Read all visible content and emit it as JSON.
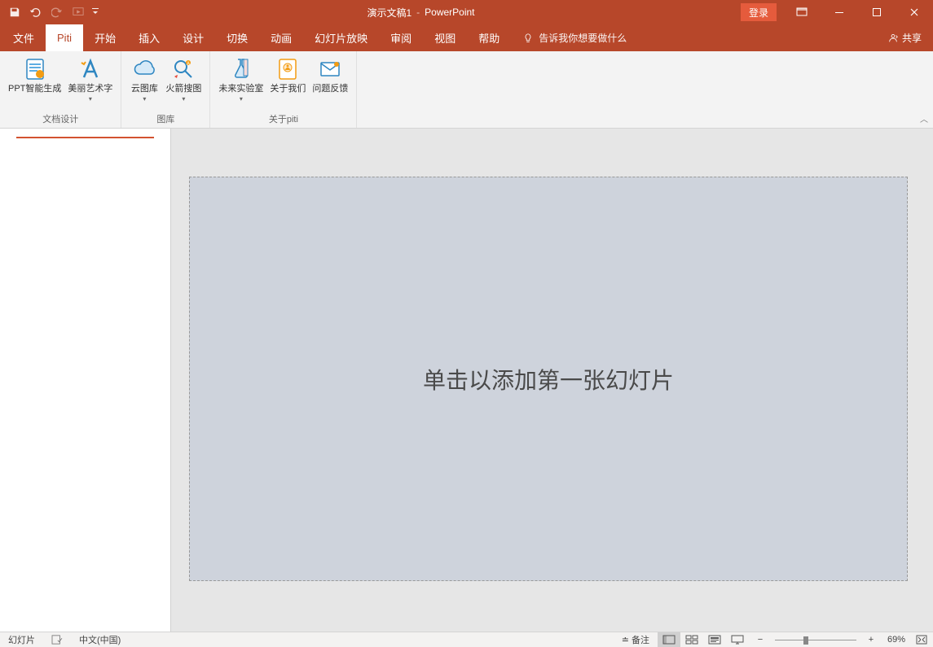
{
  "title": {
    "document": "演示文稿1",
    "separator": "-",
    "app": "PowerPoint"
  },
  "login_label": "登录",
  "tabs": [
    {
      "label": "文件"
    },
    {
      "label": "Piti",
      "active": true
    },
    {
      "label": "开始"
    },
    {
      "label": "插入"
    },
    {
      "label": "设计"
    },
    {
      "label": "切换"
    },
    {
      "label": "动画"
    },
    {
      "label": "幻灯片放映"
    },
    {
      "label": "审阅"
    },
    {
      "label": "视图"
    },
    {
      "label": "帮助"
    }
  ],
  "tell_me": "告诉我你想要做什么",
  "share_label": "共享",
  "ribbon": {
    "groups": [
      {
        "name": "文档设计",
        "items": [
          {
            "id": "ppt-gen",
            "label": "PPT智能生成",
            "icon": "doc"
          },
          {
            "id": "art-text",
            "label": "美丽艺术字",
            "icon": "art",
            "dropdown": true
          }
        ]
      },
      {
        "name": "图库",
        "items": [
          {
            "id": "cloud-lib",
            "label": "云图库",
            "icon": "cloud",
            "dropdown": true
          },
          {
            "id": "rocket-search",
            "label": "火箭搜图",
            "icon": "rocket",
            "dropdown": true
          }
        ]
      },
      {
        "name": "关于piti",
        "items": [
          {
            "id": "future-lab",
            "label": "未来实验室",
            "icon": "lab",
            "dropdown": true
          },
          {
            "id": "about-us",
            "label": "关于我们",
            "icon": "about"
          },
          {
            "id": "feedback",
            "label": "问题反馈",
            "icon": "mail"
          }
        ]
      }
    ]
  },
  "slide": {
    "placeholder_text": "单击以添加第一张幻灯片"
  },
  "status": {
    "slide_label": "幻灯片",
    "language": "中文(中国)",
    "notes": "备注",
    "zoom_pct": "69%"
  }
}
